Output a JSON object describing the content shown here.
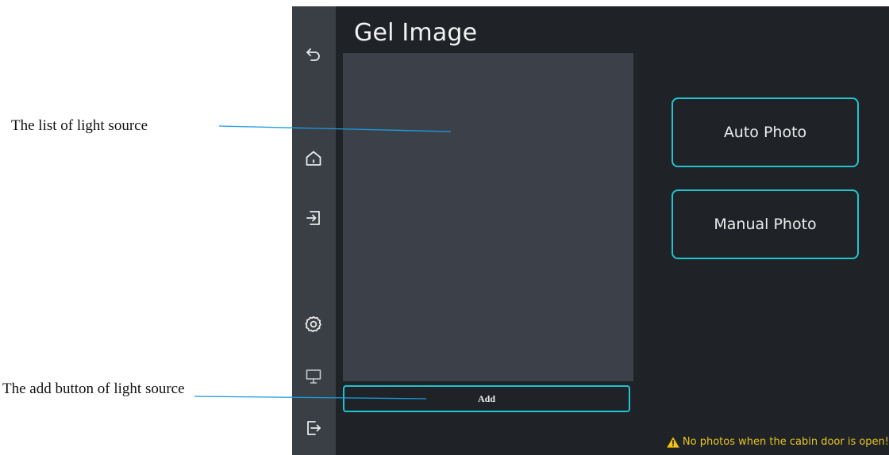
{
  "annotations": {
    "list_label": "The list of light source",
    "add_label": "The add button of light source"
  },
  "app": {
    "title": "Gel Image",
    "sidebar": {
      "icons": [
        "back-icon",
        "home-icon",
        "login-icon",
        "settings-icon",
        "monitor-icon",
        "logout-icon"
      ]
    },
    "light_source_list": {
      "items": []
    },
    "add_button_label": "Add",
    "actions": {
      "auto_photo_label": "Auto Photo",
      "manual_photo_label": "Manual Photo"
    },
    "warning_text": "No photos when the cabin door is open!"
  },
  "colors": {
    "accent": "#20c4cf",
    "background": "#1f2328",
    "sidebar": "#3a3f46",
    "panel": "#3c4149",
    "warning": "#e8c41b",
    "leader_line": "#1a9be0"
  }
}
